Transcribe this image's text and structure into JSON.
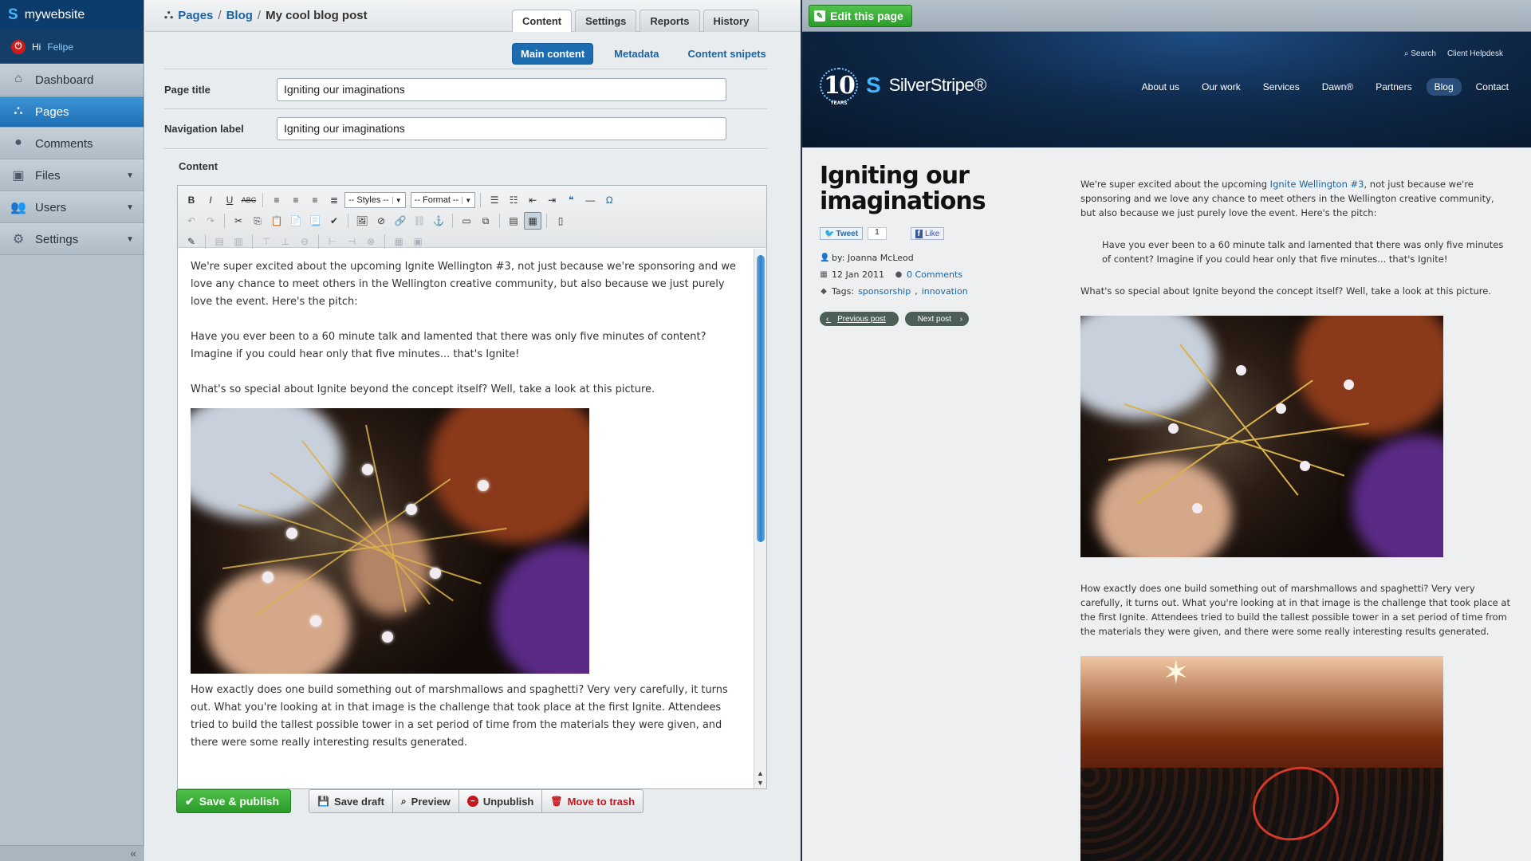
{
  "cms": {
    "site_name": "mywebsite",
    "greeting": "Hi",
    "user_name": "Felipe",
    "nav": [
      {
        "label": "Dashboard",
        "icon": "home-icon"
      },
      {
        "label": "Pages",
        "icon": "sitemap-icon",
        "active": true
      },
      {
        "label": "Comments",
        "icon": "comment-icon"
      },
      {
        "label": "Files",
        "icon": "image-icon",
        "has_submenu": true
      },
      {
        "label": "Users",
        "icon": "users-icon",
        "has_submenu": true
      },
      {
        "label": "Settings",
        "icon": "gear-icon",
        "has_submenu": true
      }
    ],
    "collapse_glyph": "«"
  },
  "editor": {
    "breadcrumb": {
      "pages": "Pages",
      "blog": "Blog",
      "current": "My cool blog post",
      "sep": "/"
    },
    "tabs": [
      "Content",
      "Settings",
      "Reports",
      "History"
    ],
    "active_tab": "Content",
    "subtabs": [
      "Main content",
      "Metadata",
      "Content snipets"
    ],
    "fields": {
      "page_title_label": "Page title",
      "page_title_value": "Igniting our imaginations",
      "nav_label_label": "Navigation label",
      "nav_label_value": "Igniting our imaginations",
      "content_label": "Content"
    },
    "toolbar": {
      "styles_select": "-- Styles --",
      "format_select": "-- Format --"
    },
    "body": {
      "p1": "We're super excited about the upcoming Ignite Wellington #3, not just because we're sponsoring and we love any chance to meet others in the Wellington creative community, but also because we just purely love the event. Here's the pitch:",
      "p2": "Have you ever been to a 60 minute talk and lamented that there was only five minutes of content? Imagine if you could hear only that five minutes... that's Ignite!",
      "p3": "What's so special about Ignite beyond the concept itself? Well, take a look at this picture.",
      "p4": "How exactly does one build something out of marshmallows and spaghetti? Very very carefully, it turns out. What you're looking at in that image is the challenge that took place at the first Ignite. Attendees tried to build the tallest possible tower in a set period of time from the materials they were given, and there were some really interesting results generated."
    },
    "actions": {
      "save_publish": "Save & publish",
      "save_draft": "Save draft",
      "preview": "Preview",
      "unpublish": "Unpublish",
      "move_to_trash": "Move to trash"
    }
  },
  "preview": {
    "edit_button": "Edit this page",
    "util": {
      "search": "Search",
      "helpdesk": "Client Helpdesk"
    },
    "logo": {
      "years_number": "10",
      "years_label": "YEARS",
      "brand": "SilverStripe®"
    },
    "nav": [
      "About us",
      "Our work",
      "Services",
      "Dawn®",
      "Partners",
      "Blog",
      "Contact"
    ],
    "active_nav": "Blog",
    "post_title": "Igniting our imaginations",
    "tweet": "Tweet",
    "tweet_count": "1",
    "like": "Like",
    "author": "by: Joanna McLeod",
    "date": "12 Jan 2011",
    "comments": "0 Comments",
    "tags_label": "Tags:",
    "tags": [
      "sponsorship",
      "innovation"
    ],
    "prev_post": "Previous post",
    "next_post": "Next post",
    "article": {
      "p1_before": "We're super excited about the upcoming ",
      "p1_link": "Ignite Wellington #3",
      "p1_after": ", not just because we're sponsoring and we love any chance to meet others in the Wellington creative community, but also because we just purely love the event. Here's the pitch:",
      "quote": "Have you ever been to a 60 minute talk and lamented that there was only five minutes of content? Imagine if you could hear only that five minutes... that's Ignite!",
      "p2": "What's so special about Ignite beyond the concept itself? Well, take a look at this picture.",
      "p3": "How exactly does one build something out of marshmallows and spaghetti? Very very carefully, it turns out. What you're looking at in that image is the challenge that took place at the first Ignite. Attendees tried to build the tallest possible tower in a set period of time from the materials they were given, and there were some really interesting results generated."
    }
  }
}
